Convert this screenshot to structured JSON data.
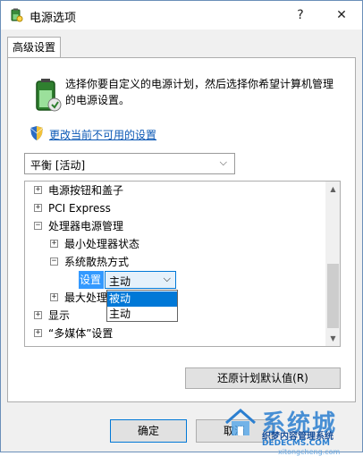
{
  "window": {
    "title": "电源选项",
    "help_glyph": "?",
    "close_glyph": "✕"
  },
  "tab": {
    "label": "高级设置"
  },
  "description": "选择你要自定义的电源计划，然后选择你希望计算机管理的电源设置。",
  "change_link": "更改当前不可用的设置",
  "plan_select": {
    "value": "平衡 [活动]",
    "chevron": "⌵"
  },
  "tree": {
    "items": [
      {
        "label": "电源按钮和盖子",
        "expander": "+"
      },
      {
        "label": "PCI Express",
        "expander": "+"
      },
      {
        "label": "处理器电源管理",
        "expander": "−"
      },
      {
        "label": "最小处理器状态",
        "expander": "+"
      },
      {
        "label": "系统散热方式",
        "expander": "−"
      },
      {
        "label": "最大处理",
        "expander": "+"
      },
      {
        "label": "显示",
        "expander": "+"
      },
      {
        "label": "“多媒体”设置",
        "expander": "+"
      }
    ],
    "setting_label": "设置",
    "setting_value": "主动",
    "setting_chevron": "⌵",
    "options": [
      "被动",
      "主动"
    ],
    "selected_option": "被动"
  },
  "buttons": {
    "restore": "还原计划默认值(R)",
    "ok": "确定",
    "cancel": "取消"
  },
  "watermark": {
    "brand": "系统城",
    "line1": "织梦内容管理系统",
    "line2": "DEDECMS.COM",
    "url": "xitongcheng.com"
  },
  "colors": {
    "link": "#0b58b5",
    "selection": "#0078d7",
    "setting_highlight": "#3399ff"
  },
  "icons": {
    "app": "power-options-icon",
    "battery": "battery-plan-icon",
    "shield": "uac-shield-icon"
  }
}
